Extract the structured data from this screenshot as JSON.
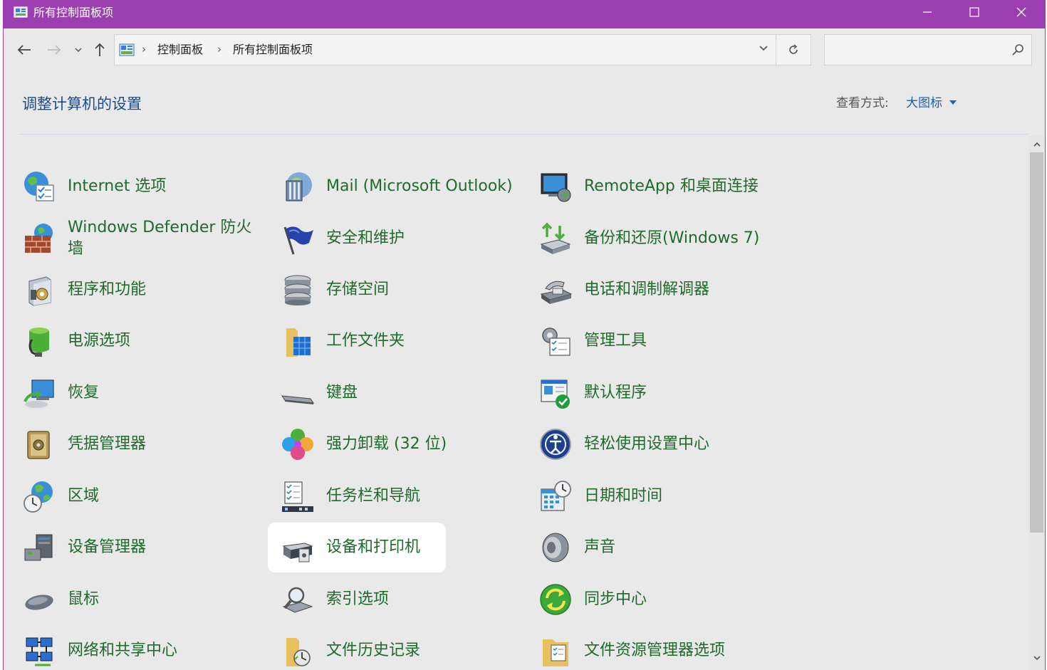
{
  "window": {
    "title": "所有控制面板项",
    "accent": "#9b3fb0"
  },
  "address_bar": {
    "crumbs": [
      "控制面板",
      "所有控制面板项"
    ]
  },
  "search": {
    "placeholder": ""
  },
  "header": {
    "title": "调整计算机的设置",
    "view_by_label": "查看方式:",
    "view_by_value": "大图标"
  },
  "items": [
    {
      "label": "Internet 选项",
      "icon": "internet-options-icon"
    },
    {
      "label": "Mail (Microsoft Outlook)",
      "icon": "mail-icon"
    },
    {
      "label": "RemoteApp 和桌面连接",
      "icon": "remoteapp-icon"
    },
    {
      "label": "Windows Defender 防火墙",
      "icon": "firewall-icon"
    },
    {
      "label": "安全和维护",
      "icon": "security-flag-icon"
    },
    {
      "label": "备份和还原(Windows 7)",
      "icon": "backup-restore-icon"
    },
    {
      "label": "程序和功能",
      "icon": "programs-icon"
    },
    {
      "label": "存储空间",
      "icon": "storage-spaces-icon"
    },
    {
      "label": "电话和调制解调器",
      "icon": "phone-modem-icon"
    },
    {
      "label": "电源选项",
      "icon": "power-options-icon"
    },
    {
      "label": "工作文件夹",
      "icon": "work-folders-icon"
    },
    {
      "label": "管理工具",
      "icon": "admin-tools-icon"
    },
    {
      "label": "恢复",
      "icon": "recovery-icon"
    },
    {
      "label": "键盘",
      "icon": "keyboard-icon"
    },
    {
      "label": "默认程序",
      "icon": "default-programs-icon"
    },
    {
      "label": "凭据管理器",
      "icon": "credential-manager-icon"
    },
    {
      "label": "强力卸载 (32 位)",
      "icon": "uninstaller-icon"
    },
    {
      "label": "轻松使用设置中心",
      "icon": "ease-of-access-icon"
    },
    {
      "label": "区域",
      "icon": "region-icon"
    },
    {
      "label": "任务栏和导航",
      "icon": "taskbar-icon"
    },
    {
      "label": "日期和时间",
      "icon": "date-time-icon"
    },
    {
      "label": "设备管理器",
      "icon": "device-manager-icon"
    },
    {
      "label": "设备和打印机",
      "icon": "printer-icon"
    },
    {
      "label": "声音",
      "icon": "sound-icon"
    },
    {
      "label": "鼠标",
      "icon": "mouse-icon"
    },
    {
      "label": "索引选项",
      "icon": "indexing-icon"
    },
    {
      "label": "同步中心",
      "icon": "sync-center-icon"
    },
    {
      "label": "网络和共享中心",
      "icon": "network-icon"
    },
    {
      "label": "文件历史记录",
      "icon": "file-history-icon"
    },
    {
      "label": "文件资源管理器选项",
      "icon": "folder-options-icon"
    }
  ]
}
